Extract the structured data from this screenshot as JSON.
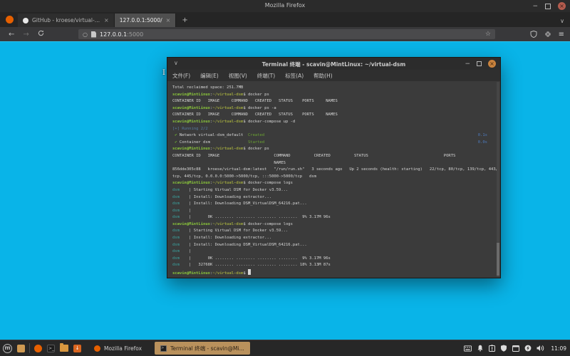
{
  "firefox": {
    "window_title": "Mozilla Firefox",
    "tabs": [
      {
        "label": "GitHub - kroese/virtual-dsm",
        "close": "×"
      },
      {
        "label": "127.0.0.1:5000/",
        "close": "×",
        "active": true
      }
    ],
    "new_tab_label": "+",
    "nav": {
      "back": "←",
      "forward": "→",
      "url_host": "127.0.0.1",
      "url_port": ":5000",
      "bookmark_star": "☆",
      "menu_glyph": "≡"
    },
    "window_controls": {
      "minimize": "−",
      "close": "×"
    }
  },
  "terminal": {
    "title": "Terminal 终端 - scavin@MintLinux: ~/virtual-dsm",
    "menu": [
      "文件(F)",
      "编辑(E)",
      "视图(V)",
      "终端(T)",
      "标签(A)",
      "帮助(H)"
    ],
    "window_controls": {
      "minimize": "−",
      "close": "×"
    },
    "prompt": [
      {
        "t": "scavin@MintLinux",
        "c": "g"
      },
      {
        "t": ":",
        "c": "d"
      },
      {
        "t": "~/virtual-dsm",
        "c": "p"
      },
      {
        "t": "$ ",
        "c": "d"
      }
    ],
    "lines": [
      {
        "s": [
          {
            "t": "Total reclaimed space: 251.7MB",
            "c": "d"
          }
        ]
      },
      {
        "p": 1,
        "cmd": "docker ps"
      },
      {
        "s": [
          {
            "t": "CONTAINER ID   IMAGE     COMMAND   CREATED   STATUS    PORTS     NAMES",
            "c": "d"
          }
        ]
      },
      {
        "p": 1,
        "cmd": "docker ps -a"
      },
      {
        "s": [
          {
            "t": "CONTAINER ID   IMAGE     COMMAND   CREATED   STATUS    PORTS     NAMES",
            "c": "d"
          }
        ]
      },
      {
        "p": 1,
        "cmd": "docker-compose up -d"
      },
      {
        "s": [
          {
            "t": "[+] Running 2/2",
            "c": "b"
          }
        ]
      },
      {
        "s": [
          {
            "t": " ✔",
            "c": "ck"
          },
          {
            "t": " Network virtual-dsm_default  ",
            "c": "d"
          },
          {
            "t": "Created",
            "c": "ok"
          },
          {
            "t": "0.1s",
            "c": "tr",
            "r": 1
          }
        ]
      },
      {
        "s": [
          {
            "t": " ✔",
            "c": "ck"
          },
          {
            "t": " Container dsm                ",
            "c": "d"
          },
          {
            "t": "Started",
            "c": "ok"
          },
          {
            "t": "0.0s",
            "c": "tr",
            "r": 1
          }
        ]
      },
      {
        "p": 1,
        "cmd": "docker ps"
      },
      {
        "s": [
          {
            "t": "CONTAINER ID   IMAGE                       COMMAND          CREATED          STATUS                                PORTS",
            "c": "d"
          }
        ]
      },
      {
        "s": [
          {
            "t": "                                           NAMES",
            "c": "d"
          }
        ]
      },
      {
        "s": [
          {
            "t": "856dde305c88   kroese/virtual-dsm:latest   \"/run/run.sh\"   3 seconds ago   Up 2 seconds (health: starting)   22/tcp, 80/tcp, 139/tcp, 443/",
            "c": "d"
          }
        ]
      },
      {
        "s": [
          {
            "t": "tcp, 445/tcp, 0.0.0.0:5000->5000/tcp, :::5000->5000/tcp   dsm",
            "c": "d"
          }
        ]
      },
      {
        "p": 1,
        "cmd": "docker-compose logs"
      },
      {
        "s": [
          {
            "t": "dsm",
            "c": "c"
          },
          {
            "t": "    | Starting Virtual DSM for Docker v3.59...",
            "c": "d"
          }
        ]
      },
      {
        "s": [
          {
            "t": "dsm",
            "c": "c"
          },
          {
            "t": "    | Install: Downloading extractor...",
            "c": "d"
          }
        ]
      },
      {
        "s": [
          {
            "t": "dsm",
            "c": "c"
          },
          {
            "t": "    | Install: Downloading DSM_VirtualDSM_64216.pat...",
            "c": "d"
          }
        ]
      },
      {
        "s": [
          {
            "t": "dsm",
            "c": "c"
          },
          {
            "t": "    |",
            "c": "d"
          }
        ]
      },
      {
        "s": [
          {
            "t": "dsm",
            "c": "c"
          },
          {
            "t": "    |       0K ........ ........ ........ ........  9% 3.17M 96s",
            "c": "d"
          }
        ]
      },
      {
        "p": 1,
        "cmd": "docker-compose logs"
      },
      {
        "s": [
          {
            "t": "dsm",
            "c": "c"
          },
          {
            "t": "    | Starting Virtual DSM for Docker v3.59...",
            "c": "d"
          }
        ]
      },
      {
        "s": [
          {
            "t": "dsm",
            "c": "c"
          },
          {
            "t": "    | Install: Downloading extractor...",
            "c": "d"
          }
        ]
      },
      {
        "s": [
          {
            "t": "dsm",
            "c": "c"
          },
          {
            "t": "    | Install: Downloading DSM_VirtualDSM_64216.pat...",
            "c": "d"
          }
        ]
      },
      {
        "s": [
          {
            "t": "dsm",
            "c": "c"
          },
          {
            "t": "    |",
            "c": "d"
          }
        ]
      },
      {
        "s": [
          {
            "t": "dsm",
            "c": "c"
          },
          {
            "t": "    |       0K ........ ........ ........ ........  9% 3.17M 96s",
            "c": "d"
          }
        ]
      },
      {
        "s": [
          {
            "t": "dsm",
            "c": "c"
          },
          {
            "t": "    |   32768K ........ ........ ........ ........ 18% 3.13M 87s",
            "c": "d"
          }
        ]
      },
      {
        "p": 1,
        "cmd": "",
        "cursor": 1
      }
    ]
  },
  "taskbar": {
    "menu_glyph": "m",
    "terminal_glyph": ">_",
    "software_glyph": "↓",
    "tasks": [
      {
        "label": "Mozilla Firefox"
      },
      {
        "label": "Terminal 终端 - scavin@Mi...",
        "active": true
      }
    ],
    "tray_icons": [
      "keyboard-icon",
      "bell-icon",
      "updates-icon",
      "shield-icon",
      "window-icon",
      "power-icon",
      "volume-icon"
    ],
    "clock": "11:09"
  },
  "colors": {
    "wallpaper_cyan": "#09b4e8",
    "prompt_green": "#8bc83b",
    "path_olive": "#9aa23e",
    "log_prefix_teal": "#3aa4a0",
    "success_green": "#6aa332",
    "time_blue": "#4d7bbf",
    "active_task_tan": "#b9915c",
    "terminal_close_orange": "#c8823d"
  }
}
